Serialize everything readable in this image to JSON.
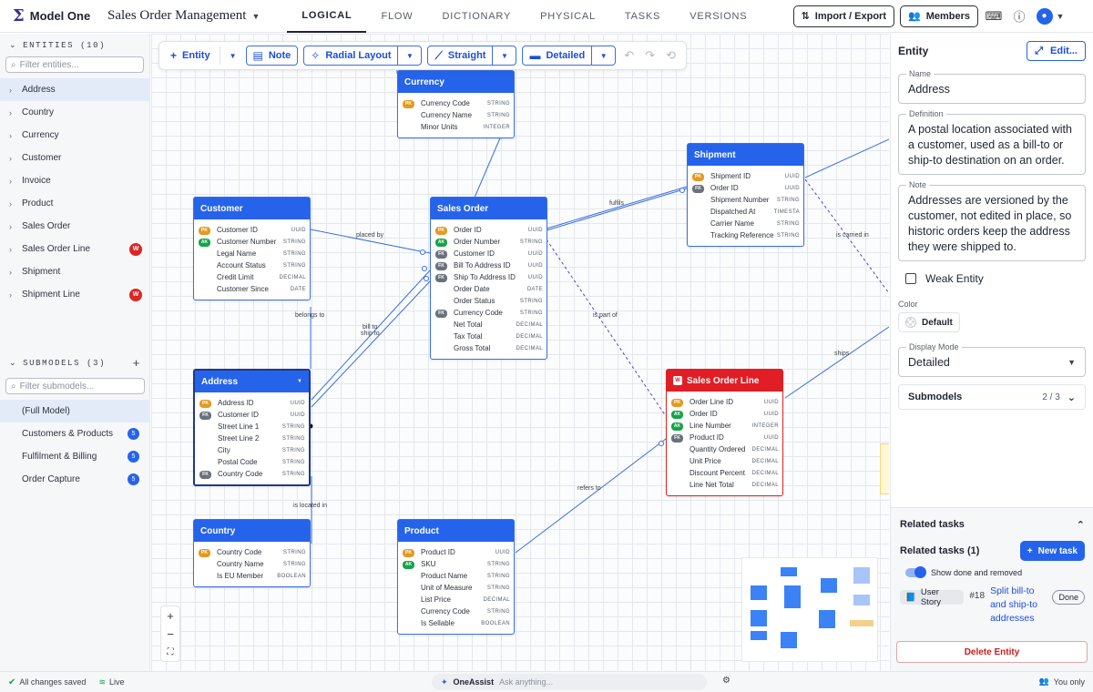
{
  "app": {
    "name": "Model One",
    "doc_title": "Sales Order Management"
  },
  "nav": {
    "tabs": [
      "LOGICAL",
      "FLOW",
      "DICTIONARY",
      "PHYSICAL",
      "TASKS",
      "VERSIONS"
    ]
  },
  "top": {
    "import_export": "Import / Export",
    "members": "Members"
  },
  "sidebar": {
    "entities_heading": "ENTITIES (10)",
    "filter_entities": "Filter entities...",
    "entities": [
      {
        "label": "Address",
        "weak": ""
      },
      {
        "label": "Country",
        "weak": ""
      },
      {
        "label": "Currency",
        "weak": ""
      },
      {
        "label": "Customer",
        "weak": ""
      },
      {
        "label": "Invoice",
        "weak": ""
      },
      {
        "label": "Product",
        "weak": ""
      },
      {
        "label": "Sales Order",
        "weak": ""
      },
      {
        "label": "Sales Order Line",
        "weak": "W"
      },
      {
        "label": "Shipment",
        "weak": ""
      },
      {
        "label": "Shipment Line",
        "weak": "W"
      }
    ],
    "submodels_heading": "SUBMODELS (3)",
    "filter_submodels": "Filter submodels...",
    "submodels": [
      {
        "label": "(Full Model)",
        "count": ""
      },
      {
        "label": "Customers & Products",
        "count": "5"
      },
      {
        "label": "Fulfilment & Billing",
        "count": "5"
      },
      {
        "label": "Order Capture",
        "count": "5"
      }
    ]
  },
  "toolbar": {
    "entity": "Entity",
    "note": "Note",
    "layout": "Radial Layout",
    "line_style": "Straight",
    "display": "Detailed"
  },
  "diagram": {
    "currency": {
      "title": "Currency",
      "rows": [
        {
          "key": "PK",
          "name": "Currency Code",
          "type": "STRING"
        },
        {
          "key": "",
          "name": "Currency Name",
          "type": "STRING"
        },
        {
          "key": "",
          "name": "Minor Units",
          "type": "INTEGER"
        }
      ]
    },
    "customer": {
      "title": "Customer",
      "rows": [
        {
          "key": "PK",
          "name": "Customer ID",
          "type": "UUID"
        },
        {
          "key": "AK",
          "name": "Customer Number",
          "type": "STRING"
        },
        {
          "key": "",
          "name": "Legal Name",
          "type": "STRING"
        },
        {
          "key": "",
          "name": "Account Status",
          "type": "STRING"
        },
        {
          "key": "",
          "name": "Credit Limit",
          "type": "DECIMAL"
        },
        {
          "key": "",
          "name": "Customer Since",
          "type": "DATE"
        }
      ]
    },
    "sales_order": {
      "title": "Sales Order",
      "rows": [
        {
          "key": "PK",
          "name": "Order ID",
          "type": "UUID"
        },
        {
          "key": "AK",
          "name": "Order Number",
          "type": "STRING"
        },
        {
          "key": "FK",
          "name": "Customer ID",
          "type": "UUID"
        },
        {
          "key": "FK",
          "name": "Bill To Address ID",
          "type": "UUID"
        },
        {
          "key": "FK",
          "name": "Ship To Address ID",
          "type": "UUID"
        },
        {
          "key": "",
          "name": "Order Date",
          "type": "DATE"
        },
        {
          "key": "",
          "name": "Order Status",
          "type": "STRING"
        },
        {
          "key": "FK",
          "name": "Currency Code",
          "type": "STRING"
        },
        {
          "key": "",
          "name": "Net Total",
          "type": "DECIMAL"
        },
        {
          "key": "",
          "name": "Tax Total",
          "type": "DECIMAL"
        },
        {
          "key": "",
          "name": "Gross Total",
          "type": "DECIMAL"
        }
      ]
    },
    "shipment": {
      "title": "Shipment",
      "rows": [
        {
          "key": "PK",
          "name": "Shipment ID",
          "type": "UUID"
        },
        {
          "key": "FK",
          "name": "Order ID",
          "type": "UUID"
        },
        {
          "key": "",
          "name": "Shipment Number",
          "type": "STRING"
        },
        {
          "key": "",
          "name": "Dispatched At",
          "type": "TIMESTA"
        },
        {
          "key": "",
          "name": "Carrier Name",
          "type": "STRING"
        },
        {
          "key": "",
          "name": "Tracking Reference",
          "type": "STRING"
        }
      ]
    },
    "address": {
      "title": "Address",
      "rows": [
        {
          "key": "PK",
          "name": "Address ID",
          "type": "UUID"
        },
        {
          "key": "FK",
          "name": "Customer ID",
          "type": "UUID"
        },
        {
          "key": "",
          "name": "Street Line 1",
          "type": "STRING"
        },
        {
          "key": "",
          "name": "Street Line 2",
          "type": "STRING"
        },
        {
          "key": "",
          "name": "City",
          "type": "STRING"
        },
        {
          "key": "",
          "name": "Postal Code",
          "type": "STRING"
        },
        {
          "key": "FK",
          "name": "Country Code",
          "type": "STRING"
        }
      ]
    },
    "sales_order_line": {
      "title": "Sales Order Line",
      "rows": [
        {
          "key": "PK",
          "name": "Order Line ID",
          "type": "UUID"
        },
        {
          "key": "AK",
          "name": "Order ID",
          "type": "UUID"
        },
        {
          "key": "AK",
          "name": "Line Number",
          "type": "INTEGER"
        },
        {
          "key": "FK",
          "name": "Product ID",
          "type": "UUID"
        },
        {
          "key": "",
          "name": "Quantity Ordered",
          "type": "DECIMAL"
        },
        {
          "key": "",
          "name": "Unit Price",
          "type": "DECIMAL"
        },
        {
          "key": "",
          "name": "Discount Percent",
          "type": "DECIMAL"
        },
        {
          "key": "",
          "name": "Line Net Total",
          "type": "DECIMAL"
        }
      ]
    },
    "country": {
      "title": "Country",
      "rows": [
        {
          "key": "PK",
          "name": "Country Code",
          "type": "STRING"
        },
        {
          "key": "",
          "name": "Country Name",
          "type": "STRING"
        },
        {
          "key": "",
          "name": "Is EU Member",
          "type": "BOOLEAN"
        }
      ]
    },
    "product": {
      "title": "Product",
      "rows": [
        {
          "key": "PK",
          "name": "Product ID",
          "type": "UUID"
        },
        {
          "key": "AK",
          "name": "SKU",
          "type": "STRING"
        },
        {
          "key": "",
          "name": "Product Name",
          "type": "STRING"
        },
        {
          "key": "",
          "name": "Unit of Measure",
          "type": "STRING"
        },
        {
          "key": "",
          "name": "List Price",
          "type": "DECIMAL"
        },
        {
          "key": "",
          "name": "Currency Code",
          "type": "STRING"
        },
        {
          "key": "",
          "name": "Is Sellable",
          "type": "BOOLEAN"
        }
      ]
    },
    "edge_labels": {
      "placed_by": "placed by",
      "fulfils": "fulfils",
      "is_carried_in": "is carried in",
      "belongs_to": "belongs to",
      "bill_to": "bill to",
      "ship_to": "ship to",
      "is_part_of": "is part of",
      "ships": "ships",
      "is_located_in": "is located in",
      "refers_to": "refers to"
    }
  },
  "panel": {
    "title": "Entity",
    "edit": "Edit...",
    "name_label": "Name",
    "name_value": "Address",
    "definition_label": "Definition",
    "definition_value": "A postal location associated with a customer, used as a bill-to or ship-to destination on an order.",
    "note_label": "Note",
    "note_value": "Addresses are versioned by the customer, not edited in place, so historic orders keep the address they were shipped to.",
    "weak_entity": "Weak Entity",
    "color_label": "Color",
    "color_value": "Default",
    "display_mode_label": "Display Mode",
    "display_mode_value": "Detailed",
    "submodels_label": "Submodels",
    "submodels_count": "2 / 3",
    "related_tasks_head": "Related tasks",
    "related_tasks_sub": "Related tasks (1)",
    "new_task": "New task",
    "show_done": "Show done and removed",
    "task_type": "User Story",
    "task_number": "#18",
    "task_title": "Split bill-to and ship-to addresses",
    "task_status": "Done",
    "delete": "Delete Entity"
  },
  "status": {
    "saved": "All changes saved",
    "live": "Live",
    "assist_name": "OneAssist",
    "assist_placeholder": "Ask anything...",
    "visibility": "You only"
  },
  "colors": {
    "accent": "#2563eb",
    "weak": "#e11d26",
    "pk": "#e49a21",
    "ak": "#16a34a",
    "fk": "#6b717c"
  }
}
